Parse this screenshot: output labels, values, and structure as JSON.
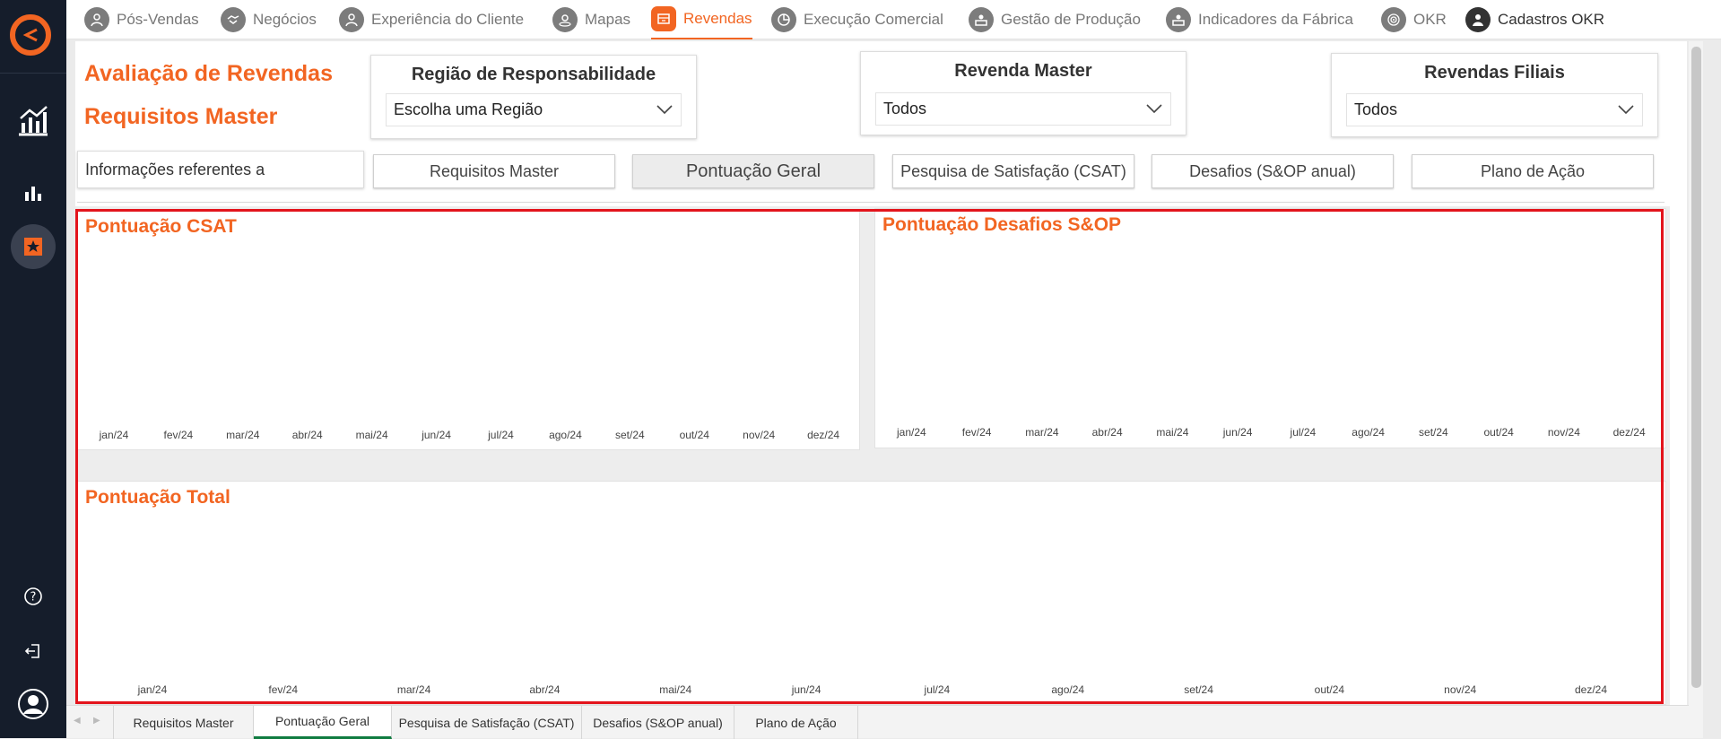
{
  "sidebar": {
    "logo_icon": "brand-logo-icon",
    "items": [
      {
        "name": "analytics-icon",
        "active": false
      },
      {
        "name": "bar-chart-icon",
        "active": false
      },
      {
        "name": "star-report-icon",
        "active": true
      }
    ],
    "bottom": [
      {
        "name": "help-icon"
      },
      {
        "name": "logout-icon"
      },
      {
        "name": "user-avatar-icon"
      }
    ]
  },
  "topnav": {
    "items": [
      {
        "label": "Pós-Vendas",
        "icon": "person-icon"
      },
      {
        "label": "Negócios",
        "icon": "handshake-icon"
      },
      {
        "label": "Experiência do Cliente",
        "icon": "person-icon"
      },
      {
        "label": "Mapas",
        "icon": "map-person-icon"
      },
      {
        "label": "Revendas",
        "icon": "store-icon",
        "active": true
      },
      {
        "label": "Execução Comercial",
        "icon": "pie-icon"
      },
      {
        "label": "Gestão de Produção",
        "icon": "production-icon"
      },
      {
        "label": "Indicadores da Fábrica",
        "icon": "factory-icon"
      },
      {
        "label": "OKR",
        "icon": "target-icon"
      },
      {
        "label": "Cadastros OKR",
        "icon": "person-icon"
      }
    ]
  },
  "report": {
    "title_line1": "Avaliação de Revendas",
    "title_line2": "Requisitos Master",
    "slicers": {
      "regiao": {
        "label": "Região de Responsabilidade",
        "value": "Escolha uma Região"
      },
      "master": {
        "label": "Revenda Master",
        "value": "Todos"
      },
      "filiais": {
        "label": "Revendas Filiais",
        "value": "Todos"
      }
    },
    "info_text": "Informações referentes a",
    "buttons": [
      {
        "label": "Requisitos Master",
        "selected": false
      },
      {
        "label": "Pontuação Geral",
        "selected": true
      },
      {
        "label": "Pesquisa de Satisfação (CSAT)",
        "selected": false
      },
      {
        "label": "Desafios (S&OP anual)",
        "selected": false
      },
      {
        "label": "Plano de Ação",
        "selected": false
      }
    ]
  },
  "chart_data": [
    {
      "type": "bar",
      "title": "Pontuação CSAT",
      "categories": [
        "jan/24",
        "fev/24",
        "mar/24",
        "abr/24",
        "mai/24",
        "jun/24",
        "jul/24",
        "ago/24",
        "set/24",
        "out/24",
        "nov/24",
        "dez/24"
      ],
      "values": []
    },
    {
      "type": "bar",
      "title": "Pontuação Desafios S&OP",
      "categories": [
        "jan/24",
        "fev/24",
        "mar/24",
        "abr/24",
        "mai/24",
        "jun/24",
        "jul/24",
        "ago/24",
        "set/24",
        "out/24",
        "nov/24",
        "dez/24"
      ],
      "values": []
    },
    {
      "type": "bar",
      "title": "Pontuação Total",
      "categories": [
        "jan/24",
        "fev/24",
        "mar/24",
        "abr/24",
        "mai/24",
        "jun/24",
        "jul/24",
        "ago/24",
        "set/24",
        "out/24",
        "nov/24",
        "dez/24"
      ],
      "values": []
    }
  ],
  "sheet_tabs": [
    {
      "label": "Requisitos Master",
      "active": false
    },
    {
      "label": "Pontuação Geral",
      "active": true
    },
    {
      "label": "Pesquisa de Satisfação (CSAT)",
      "active": false
    },
    {
      "label": "Desafios (S&OP anual)",
      "active": false
    },
    {
      "label": "Plano de Ação",
      "active": false
    }
  ],
  "colors": {
    "accent": "#f26522",
    "sidebar": "#151d2b",
    "highlight": "#e3141c",
    "tab_active": "#107c41"
  }
}
